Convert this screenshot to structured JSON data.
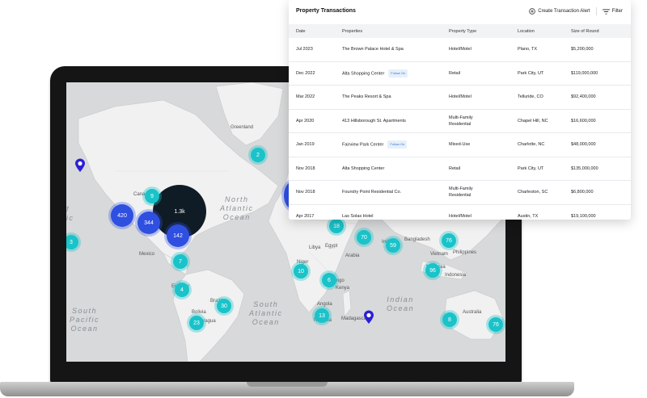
{
  "map": {
    "labels": {
      "greenland": "Greenland",
      "canada": "Canada",
      "mexico": "Mexico",
      "ecuador": "Ecuador",
      "brazil": "Brazil",
      "bolivia": "Bolivia",
      "paraguay": "Paragua",
      "india": "India",
      "bangladesh": "Bangladesh",
      "libya": "Libya",
      "egypt": "Egypt",
      "arabia": "Arabia",
      "niger": "Niger",
      "kenya": "Kenya",
      "indonesia": "Indonesia",
      "australia": "Australia",
      "philippines": "Philippines",
      "madagascar": "Madagascar",
      "namibia": "Namibia",
      "congo": "Congo",
      "angola": "Angola",
      "vietnam": "Vietnam",
      "malaysia": "Malaysia"
    },
    "oceans": {
      "north_atlantic": "North\nAtlantic\nOcean",
      "south_atlantic": "South\nAtlantic\nOcean",
      "south_pacific": "South\nPacific\nOcean",
      "indian": "Indian\nOcean",
      "pacific_fragment": "f\nic"
    },
    "clusters": {
      "na_dark": "1.3k",
      "west_us": "420",
      "mexico": "344",
      "central_am": "142",
      "canada": "9",
      "greenland": "2",
      "colombia": "7",
      "peru": "4",
      "brazil": "30",
      "argentina": "23",
      "pacific_edge": "3",
      "nafrica": "18",
      "egypt": "70",
      "india": "59",
      "se_asia": "76",
      "indonesia": "96",
      "east_africa": "6",
      "central_africa": "10",
      "south_africa": "13",
      "australia_w": "8",
      "australia_e": "76"
    }
  },
  "panel": {
    "title": "Property Transactions",
    "create_alert": "Create Transaction Alert",
    "filter": "Filter",
    "columns": [
      "Date",
      "Properties",
      "Property Type",
      "Location",
      "Size of Round"
    ],
    "rows": [
      {
        "date": "Jul 2023",
        "property": "The Brown Palace Hotel & Spa",
        "badge": "",
        "type": "Hotel/Motel",
        "location": "Plano, TX",
        "size": "$5,200,000"
      },
      {
        "date": "Dec 2022",
        "property": "Alta Shopping Center",
        "badge": "Follow On",
        "type": "Retail",
        "location": "Park City, UT",
        "size": "$119,000,000"
      },
      {
        "date": "Mar 2022",
        "property": "The Peaks Resort & Spa",
        "badge": "",
        "type": "Hotel/Motel",
        "location": "Telluride, CO",
        "size": "$92,400,000"
      },
      {
        "date": "Apr 2020",
        "property": "413 Hillsborough St. Apartments",
        "badge": "",
        "type": "Multi-Family Residential",
        "location": "Chapel Hill, NC",
        "size": "$16,600,000"
      },
      {
        "date": "Jan 2019",
        "property": "Fairview Park Center",
        "badge": "Follow On",
        "type": "Mixed-Use",
        "location": "Charlotte, NC",
        "size": "$48,000,000"
      },
      {
        "date": "Nov 2018",
        "property": "Alta Shopping Center",
        "badge": "",
        "type": "Retail",
        "location": "Park City, UT",
        "size": "$135,000,000"
      },
      {
        "date": "Nov 2018",
        "property": "Foundry Point Residential Co.",
        "badge": "",
        "type": "Multi-Family Residential",
        "location": "Charleston, SC",
        "size": "$6,800,000"
      },
      {
        "date": "Apr 2017",
        "property": "Las Solas Hotel",
        "badge": "",
        "type": "Hotel/Motel",
        "location": "Austin, TX",
        "size": "$19,100,000"
      }
    ]
  },
  "colors": {
    "cluster_teal": "#19c3c9",
    "cluster_blue": "#2f4fe0",
    "cluster_dark": "#0f1c26",
    "pin": "#2a1fd6"
  }
}
